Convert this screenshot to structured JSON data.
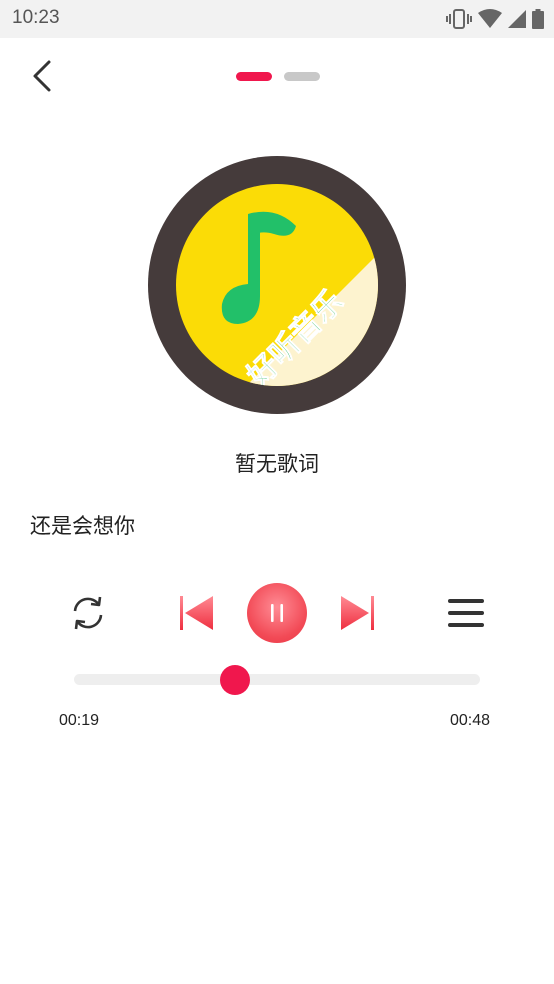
{
  "status_bar": {
    "time": "10:23",
    "icons": [
      "vibrate-icon",
      "wifi-icon",
      "cellular-signal-icon",
      "battery-icon"
    ]
  },
  "header": {
    "back_icon": "chevron-left-icon",
    "pages": [
      {
        "active": true
      },
      {
        "active": false
      }
    ]
  },
  "album": {
    "logo_text": "好听音乐",
    "icon": "music-note-icon",
    "colors": {
      "ring": "#453b3b",
      "disc": "#fbdc06",
      "note": "#22c069",
      "banner": "#fdf3cf"
    }
  },
  "lyrics": {
    "status": "暂无歌词"
  },
  "song": {
    "title": "还是会想你"
  },
  "controls": {
    "loop_icon": "repeat-icon",
    "prev_icon": "skip-previous-icon",
    "play_icon": "pause-icon",
    "next_icon": "skip-next-icon",
    "playlist_icon": "menu-icon"
  },
  "progress": {
    "current_time": "00:19",
    "total_time": "00:48",
    "fraction": 0.3958
  },
  "colors": {
    "accent": "#f0174d",
    "play_button": "#f24a56"
  }
}
